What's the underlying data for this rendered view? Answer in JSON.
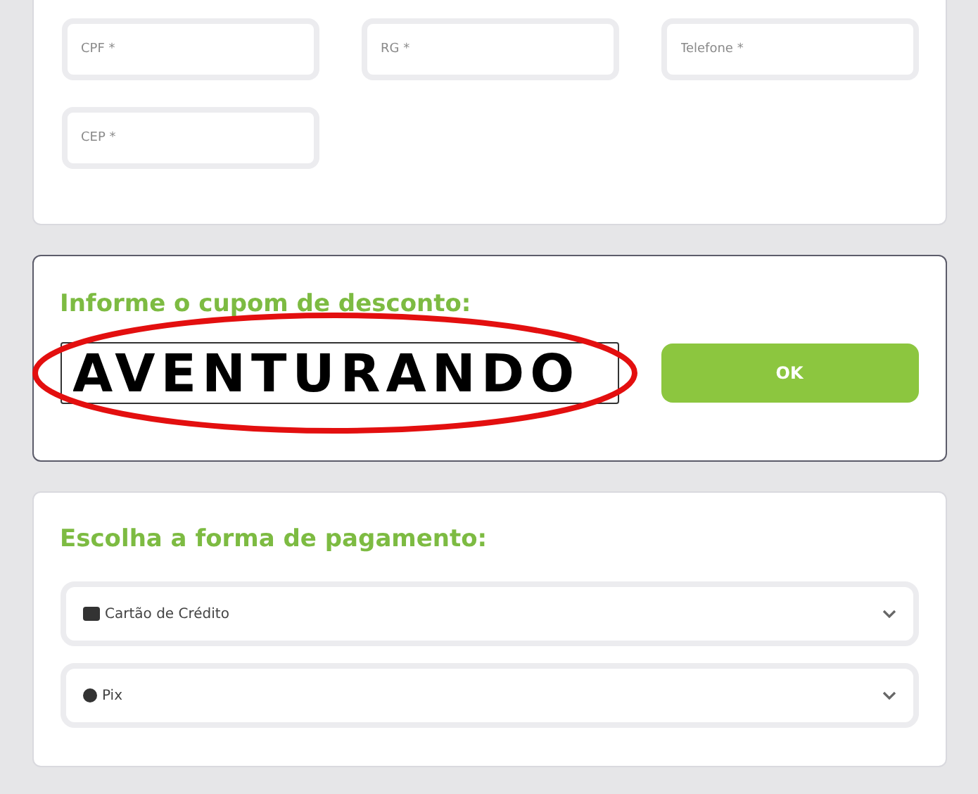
{
  "personal_fields": [
    {
      "placeholder": "CPF *"
    },
    {
      "placeholder": "RG *"
    },
    {
      "placeholder": "Telefone *"
    },
    {
      "placeholder": "CEP *"
    }
  ],
  "coupon": {
    "label": "Informe o cupom de desconto:",
    "value": "AVENTURANDO",
    "button": "OK"
  },
  "payment": {
    "title": "Escolha a forma de pagamento:",
    "options": [
      {
        "kind": "card",
        "label": "Cartão de Crédito"
      },
      {
        "kind": "pix",
        "label": "Pix"
      }
    ]
  }
}
